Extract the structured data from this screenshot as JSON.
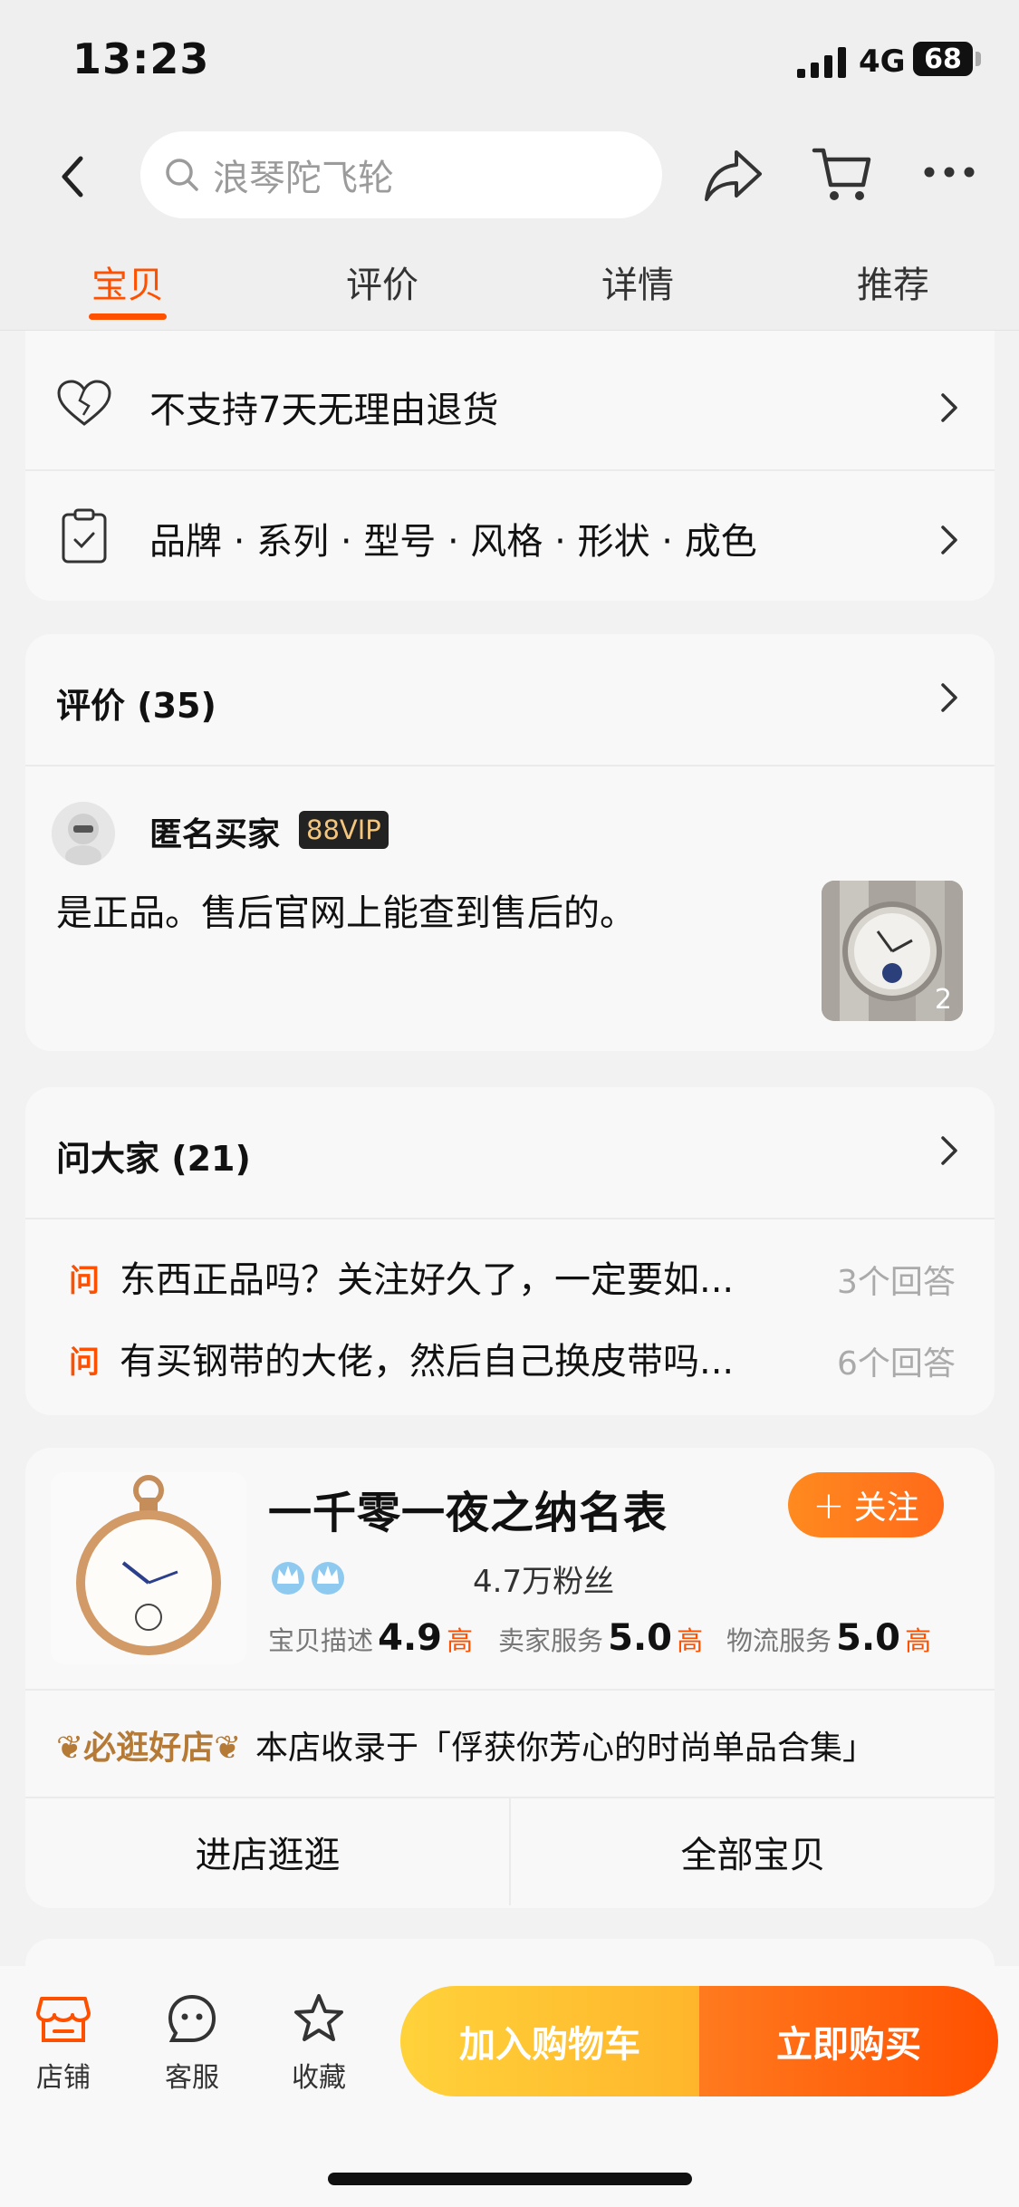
{
  "status_bar": {
    "time": "13:23",
    "network": "4G",
    "battery": "68"
  },
  "header": {
    "search_placeholder": "浪琴陀飞轮",
    "tabs": [
      {
        "label": "宝贝",
        "active": true
      },
      {
        "label": "评价",
        "active": false
      },
      {
        "label": "详情",
        "active": false
      },
      {
        "label": "推荐",
        "active": false
      }
    ]
  },
  "service_rows": [
    {
      "label": "不支持7天无理由退货",
      "icon": "heart-outline-icon"
    },
    {
      "label": "品牌 · 系列 · 型号 · 风格 · 形状 · 成色",
      "icon": "clipboard-check-icon"
    }
  ],
  "reviews": {
    "title": "评价 (35)",
    "item": {
      "user": "匿名买家",
      "badge": "88VIP",
      "text": "是正品。售后官网上能查到售后的。",
      "photo_count": "2"
    }
  },
  "questions": {
    "title": "问大家 (21)",
    "marker": "问",
    "items": [
      {
        "text": "东西正品吗？关注好久了，一定要如...",
        "answers": "3个回答"
      },
      {
        "text": "有买钢带的大佬，然后自己换皮带吗...",
        "answers": "6个回答"
      }
    ]
  },
  "shop": {
    "name": "一千零一夜之纳名表",
    "follow_label": "关注",
    "fans": "4.7万粉丝",
    "ratings": [
      {
        "label": "宝贝描述",
        "score": "4.9",
        "level": "高"
      },
      {
        "label": "卖家服务",
        "score": "5.0",
        "level": "高"
      },
      {
        "label": "物流服务",
        "score": "5.0",
        "level": "高"
      }
    ],
    "must_visit_badge": "必逛好店",
    "collection_text": "本店收录于「俘获你芳心的时尚单品合集」",
    "actions": [
      "进店逛逛",
      "全部宝贝"
    ]
  },
  "bottom_bar": {
    "items": [
      {
        "label": "店铺",
        "icon": "store-icon"
      },
      {
        "label": "客服",
        "icon": "customer-service-icon"
      },
      {
        "label": "收藏",
        "icon": "star-icon"
      }
    ],
    "add_to_cart": "加入购物车",
    "buy_now": "立即购买"
  },
  "colors": {
    "accent": "#ff5000",
    "cart_button": "#ffc030",
    "buy_button": "#ff6a1a"
  }
}
